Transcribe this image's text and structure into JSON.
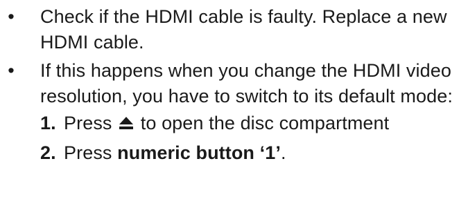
{
  "bullets": [
    {
      "marker": "•",
      "text": "Check if the HDMI cable is faulty. Replace a new HDMI cable."
    },
    {
      "marker": "•",
      "text": "If this happens when you change the HDMI video resolution, you have to switch to its default mode:",
      "steps": [
        {
          "number": "1.",
          "prefix": "Press",
          "icon": "eject-icon",
          "suffix": "to open the disc compartment"
        },
        {
          "number": "2.",
          "prefix": "Press",
          "bold_text": "numeric button ‘1’",
          "suffix": "."
        }
      ]
    }
  ]
}
